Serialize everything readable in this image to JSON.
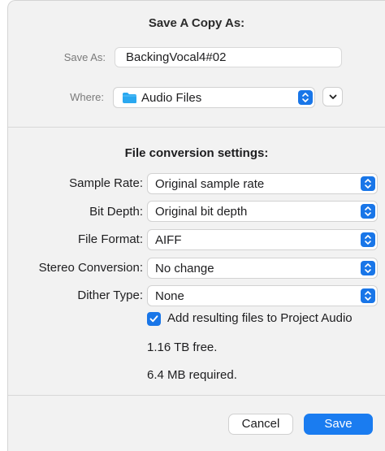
{
  "dialog": {
    "title": "Save A Copy As:"
  },
  "save_as": {
    "label": "Save As:",
    "value": "BackingVocal4#02"
  },
  "where": {
    "label": "Where:",
    "value": "Audio Files",
    "icon": "folder-icon"
  },
  "settings": {
    "title": "File conversion settings:",
    "rows": [
      {
        "label": "Sample Rate:",
        "value": "Original sample rate"
      },
      {
        "label": "Bit Depth:",
        "value": "Original bit depth"
      },
      {
        "label": "File Format:",
        "value": "AIFF"
      },
      {
        "label": "Stereo Conversion:",
        "value": "No change"
      },
      {
        "label": "Dither Type:",
        "value": "None"
      }
    ],
    "add_to_project": {
      "label": "Add resulting files to Project Audio",
      "checked": true
    },
    "free_space": "1.16 TB free.",
    "required_space": "6.4 MB required."
  },
  "buttons": {
    "cancel": "Cancel",
    "save": "Save"
  },
  "colors": {
    "accent": "#1976e8",
    "background": "#f2f2f2",
    "folder": "#2aa8f0"
  }
}
